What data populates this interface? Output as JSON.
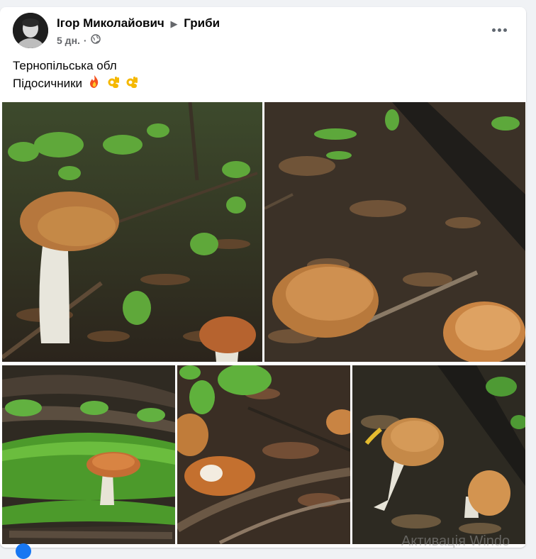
{
  "post": {
    "author": "Ігор Миколайович",
    "group": "Гриби",
    "time": "5 дн.",
    "privacy_icon": "globe-icon",
    "text_line1": "Тернопільська обл",
    "text_line2": "Підосичники",
    "emojis": [
      "fire",
      "ok-hand",
      "ok-hand"
    ]
  },
  "photos": [
    {
      "name": "photo-1",
      "subject": "mushroom"
    },
    {
      "name": "photo-2",
      "subject": "mushroom"
    },
    {
      "name": "photo-3",
      "subject": "mushroom"
    },
    {
      "name": "photo-4",
      "subject": "mushroom"
    },
    {
      "name": "photo-5",
      "subject": "mushroom"
    }
  ],
  "watermark": "Активація Windo",
  "colors": {
    "accent": "#1877f2",
    "cap": "#c07a3a",
    "forest_dark": "#3a3326"
  }
}
